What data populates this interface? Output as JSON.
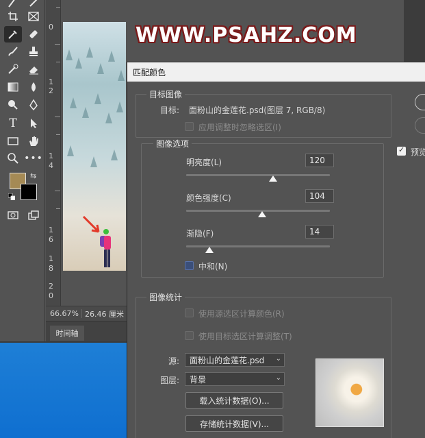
{
  "banner": {
    "text": "WWW.PSAHZ.COM"
  },
  "ruler": {
    "labels": [
      "0",
      "1",
      "2",
      "1",
      "4",
      "1",
      "6",
      "1",
      "8",
      "2",
      "0"
    ]
  },
  "status": {
    "zoom": "66.67%",
    "size": "26.46 厘米 ×"
  },
  "timeline": {
    "label": "时间轴"
  },
  "dialog": {
    "title": "匹配颜色",
    "target_group": {
      "title": "目标图像",
      "target_label": "目标:",
      "target_value": "面粉山的金莲花.psd(图层 7, RGB/8)",
      "ignore_selection_label": "应用调整时忽略选区(I)"
    },
    "options_group": {
      "title": "图像选项",
      "luminance": {
        "label": "明亮度(L)",
        "value": "120"
      },
      "intensity": {
        "label": "颜色强度(C)",
        "value": "104"
      },
      "fade": {
        "label": "渐隐(F)",
        "value": "14"
      },
      "neutralize_label": "中和(N)"
    },
    "stats_group": {
      "title": "图像统计",
      "use_source_selection_label": "使用源选区计算颜色(R)",
      "use_target_selection_label": "使用目标选区计算调整(T)",
      "source_label": "源:",
      "source_value": "面粉山的金莲花.psd",
      "layer_label": "图层:",
      "layer_value": "背景",
      "load_stats_label": "载入统计数据(O)...",
      "save_stats_label": "存储统计数据(V)..."
    },
    "preview_label": "预览"
  }
}
